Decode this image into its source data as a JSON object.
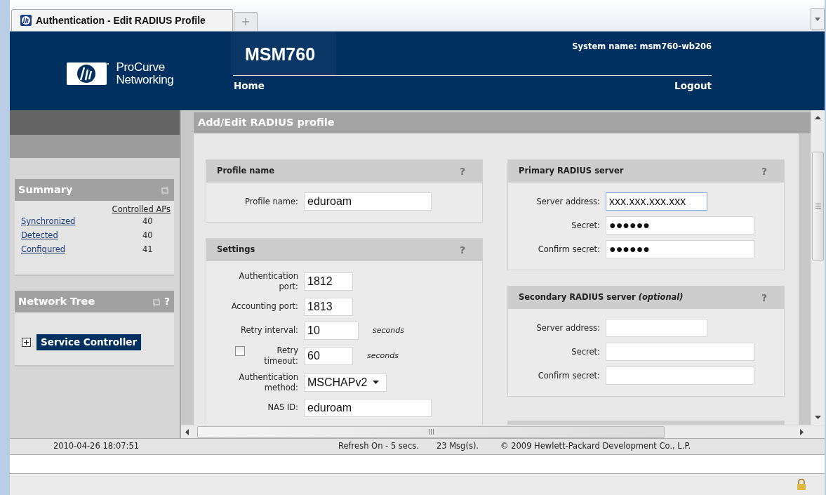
{
  "browser": {
    "tabs": [
      {
        "label": "Authentication - Edit RADIUS Profile",
        "selected": true
      }
    ]
  },
  "header": {
    "logo_text": "ProCurve",
    "logo_subtext": "Networking",
    "product": "MSM760",
    "system_name": "System name: msm760-wb206",
    "nav": [
      {
        "label": "Home"
      },
      {
        "label": "Logout"
      }
    ]
  },
  "sidebar": {
    "summary": {
      "title": "Summary",
      "column": "Controlled APs",
      "rows": [
        {
          "label": "Synchronized",
          "value": "40"
        },
        {
          "label": "Detected",
          "value": "40"
        },
        {
          "label": "Configured",
          "value": "41"
        }
      ]
    },
    "network_tree": {
      "title": "Network Tree",
      "help": "?",
      "items": [
        {
          "label": "Service Controller",
          "expanded": false,
          "selected": true
        }
      ]
    }
  },
  "page": {
    "title": "Add/Edit RADIUS profile",
    "columns": [
      [
        {
          "title": "Profile name",
          "help": "?",
          "fields": [
            {
              "kind": "text",
              "label": "Profile name:",
              "value": "eduroam"
            }
          ]
        },
        {
          "title": "Settings",
          "help": "?",
          "fields": [
            {
              "kind": "text",
              "label": "Authentication port:",
              "value": "1812"
            },
            {
              "kind": "text",
              "label": "Accounting port:",
              "value": "1813"
            },
            {
              "kind": "text",
              "label": "Retry interval:",
              "value": "10",
              "unit": "seconds"
            },
            {
              "kind": "checkbox-text",
              "label": "Retry timeout:",
              "value": "60",
              "unit": "seconds",
              "checked": false
            },
            {
              "kind": "select",
              "label": "Authentication method:",
              "value": "MSCHAPv2"
            },
            {
              "kind": "text",
              "label": "NAS ID:",
              "value": "eduroam"
            }
          ]
        }
      ],
      [
        {
          "title": "Primary RADIUS server",
          "help": "?",
          "fields": [
            {
              "kind": "text",
              "label": "Server address:",
              "value": "xxx.xxx.xxx.xxx",
              "focused": true
            },
            {
              "kind": "text",
              "label": "Secret:",
              "value": "●●●●●●"
            },
            {
              "kind": "text",
              "label": "Confirm secret:",
              "value": "●●●●●●"
            }
          ]
        },
        {
          "title": "Secondary RADIUS server *(optional)*",
          "help": "?",
          "fields": [
            {
              "kind": "text",
              "label": "Server address:"
            },
            {
              "kind": "text",
              "label": "Secret:"
            },
            {
              "kind": "text",
              "label": "Confirm secret:"
            }
          ]
        }
      ]
    ]
  },
  "status": {
    "datetime": "2010-04-26 18:07:51",
    "refresh": "Refresh On - 5 secs.",
    "messages": "23 Msg(s).",
    "copyright": "© 2009 Hewlett-Packard Development Co., L.P."
  }
}
